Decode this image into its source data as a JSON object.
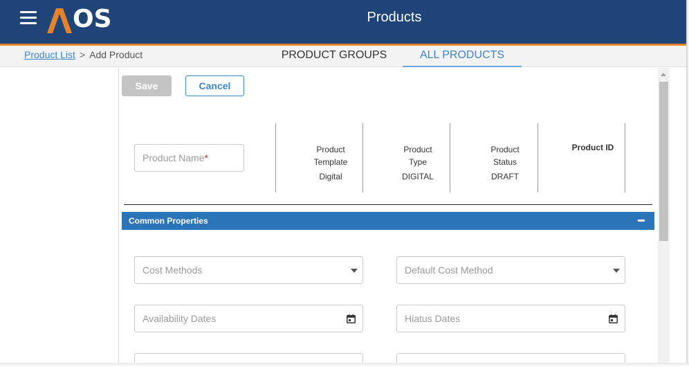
{
  "header": {
    "logo_text": "OS",
    "title": "Products",
    "colors": {
      "bar": "#1e4478",
      "accent": "#e6822a"
    }
  },
  "breadcrumb": {
    "link": "Product List",
    "separator": ">",
    "current": "Add Product"
  },
  "tabs": [
    {
      "label": "PRODUCT GROUPS",
      "active": false
    },
    {
      "label": "ALL PRODUCTS",
      "active": true
    }
  ],
  "toolbar": {
    "save_label": "Save",
    "cancel_label": "Cancel"
  },
  "product_name": {
    "placeholder": "Product Name",
    "required_mark": "*"
  },
  "meta": {
    "template_label_1": "Product",
    "template_label_2": "Template",
    "template_value": "Digital",
    "type_label_1": "Product",
    "type_label_2": "Type",
    "type_value": "DIGITAL",
    "status_label_1": "Product",
    "status_label_2": "Status",
    "status_value": "DRAFT",
    "id_label": "Product ID"
  },
  "section": {
    "title": "Common Properties",
    "collapse_icon": "minus-icon"
  },
  "fields": {
    "cost_methods": "Cost Methods",
    "default_cost_method": "Default Cost Method",
    "availability_dates": "Availability Dates",
    "hiatus_dates": "Hiatus Dates"
  },
  "icons": {
    "menu": "hamburger-icon",
    "dropdown": "chevron-down-icon",
    "calendar": "calendar-icon"
  },
  "colors": {
    "link": "#3b86c9",
    "section": "#2c74b8",
    "save_disabled": "#c4c4c4",
    "required": "#b0272d"
  }
}
